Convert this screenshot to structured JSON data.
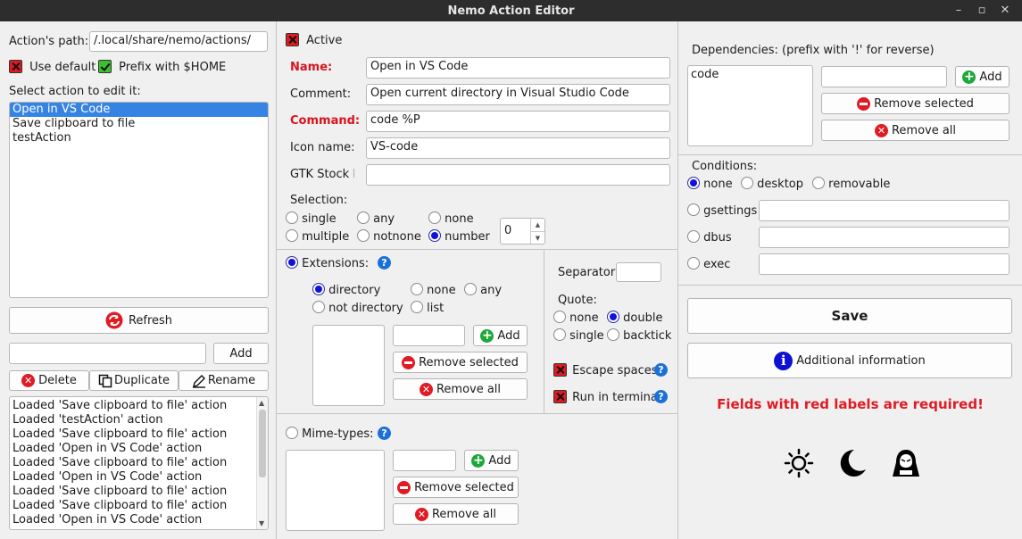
{
  "window": {
    "title": "Nemo Action Editor",
    "min": "–",
    "restore": "▫",
    "close": "✕"
  },
  "left": {
    "path_label": "Action's path:",
    "path_value": "/.local/share/nemo/actions/",
    "use_default": "Use default",
    "prefix_home": "Prefix with $HOME",
    "select_label": "Select action to edit it:",
    "actions": [
      "Open in VS Code",
      "Save clipboard to file",
      "testAction"
    ],
    "refresh": "Refresh",
    "new_value": "",
    "add": "Add",
    "delete": "Delete",
    "duplicate": "Duplicate",
    "rename": "Rename",
    "log": [
      "Loaded 'Save clipboard to file' action",
      "Loaded 'testAction' action",
      "Loaded 'Save clipboard to file' action",
      "Loaded 'Open in VS Code' action",
      "Loaded 'Save clipboard to file' action",
      "Loaded 'Open in VS Code' action",
      "Loaded 'Save clipboard to file' action",
      "Loaded 'Save clipboard to file' action",
      "Loaded 'Open in VS Code' action"
    ]
  },
  "middle": {
    "active": "Active",
    "name_label": "Name:",
    "name_value": "Open in VS Code",
    "comment_label": "Comment:",
    "comment_value": "Open current directory in Visual Studio Code",
    "command_label": "Command:",
    "command_value": "code %P",
    "icon_label": "Icon name:",
    "icon_value": "VS-code",
    "gtk_label": "GTK Stock II",
    "gtk_value": "",
    "selection_label": "Selection:",
    "sel_single": "single",
    "sel_any": "any",
    "sel_none": "none",
    "sel_multiple": "multiple",
    "sel_notnone": "notnone",
    "sel_number": "number",
    "number_value": "0",
    "extensions": "Extensions:",
    "ext_directory": "directory",
    "ext_none": "none",
    "ext_any": "any",
    "ext_notdirectory": "not directory",
    "ext_list": "list",
    "add": "Add",
    "remove_selected": "Remove selected",
    "remove_all": "Remove all",
    "separator": "Separator:",
    "separator_value": "",
    "quote": "Quote:",
    "q_none": "none",
    "q_double": "double",
    "q_single": "single",
    "q_backtick": "backtick",
    "escape_spaces": "Escape spaces",
    "run_terminal": "Run in terminal",
    "mimetypes": "Mime-types:"
  },
  "right": {
    "deps_label": "Dependencies: (prefix with '!' for reverse)",
    "deps": [
      "code"
    ],
    "add": "Add",
    "remove_selected": "Remove selected",
    "remove_all": "Remove all",
    "conditions": "Conditions:",
    "c_none": "none",
    "c_desktop": "desktop",
    "c_removable": "removable",
    "c_gsettings": "gsettings",
    "c_dbus": "dbus",
    "c_exec": "exec",
    "save": "Save",
    "info": "Additional information",
    "required": "Fields with red labels are required!"
  },
  "colors": {
    "required": "#d8131e",
    "selection": "#3584e4",
    "radio": "#1010e0"
  }
}
